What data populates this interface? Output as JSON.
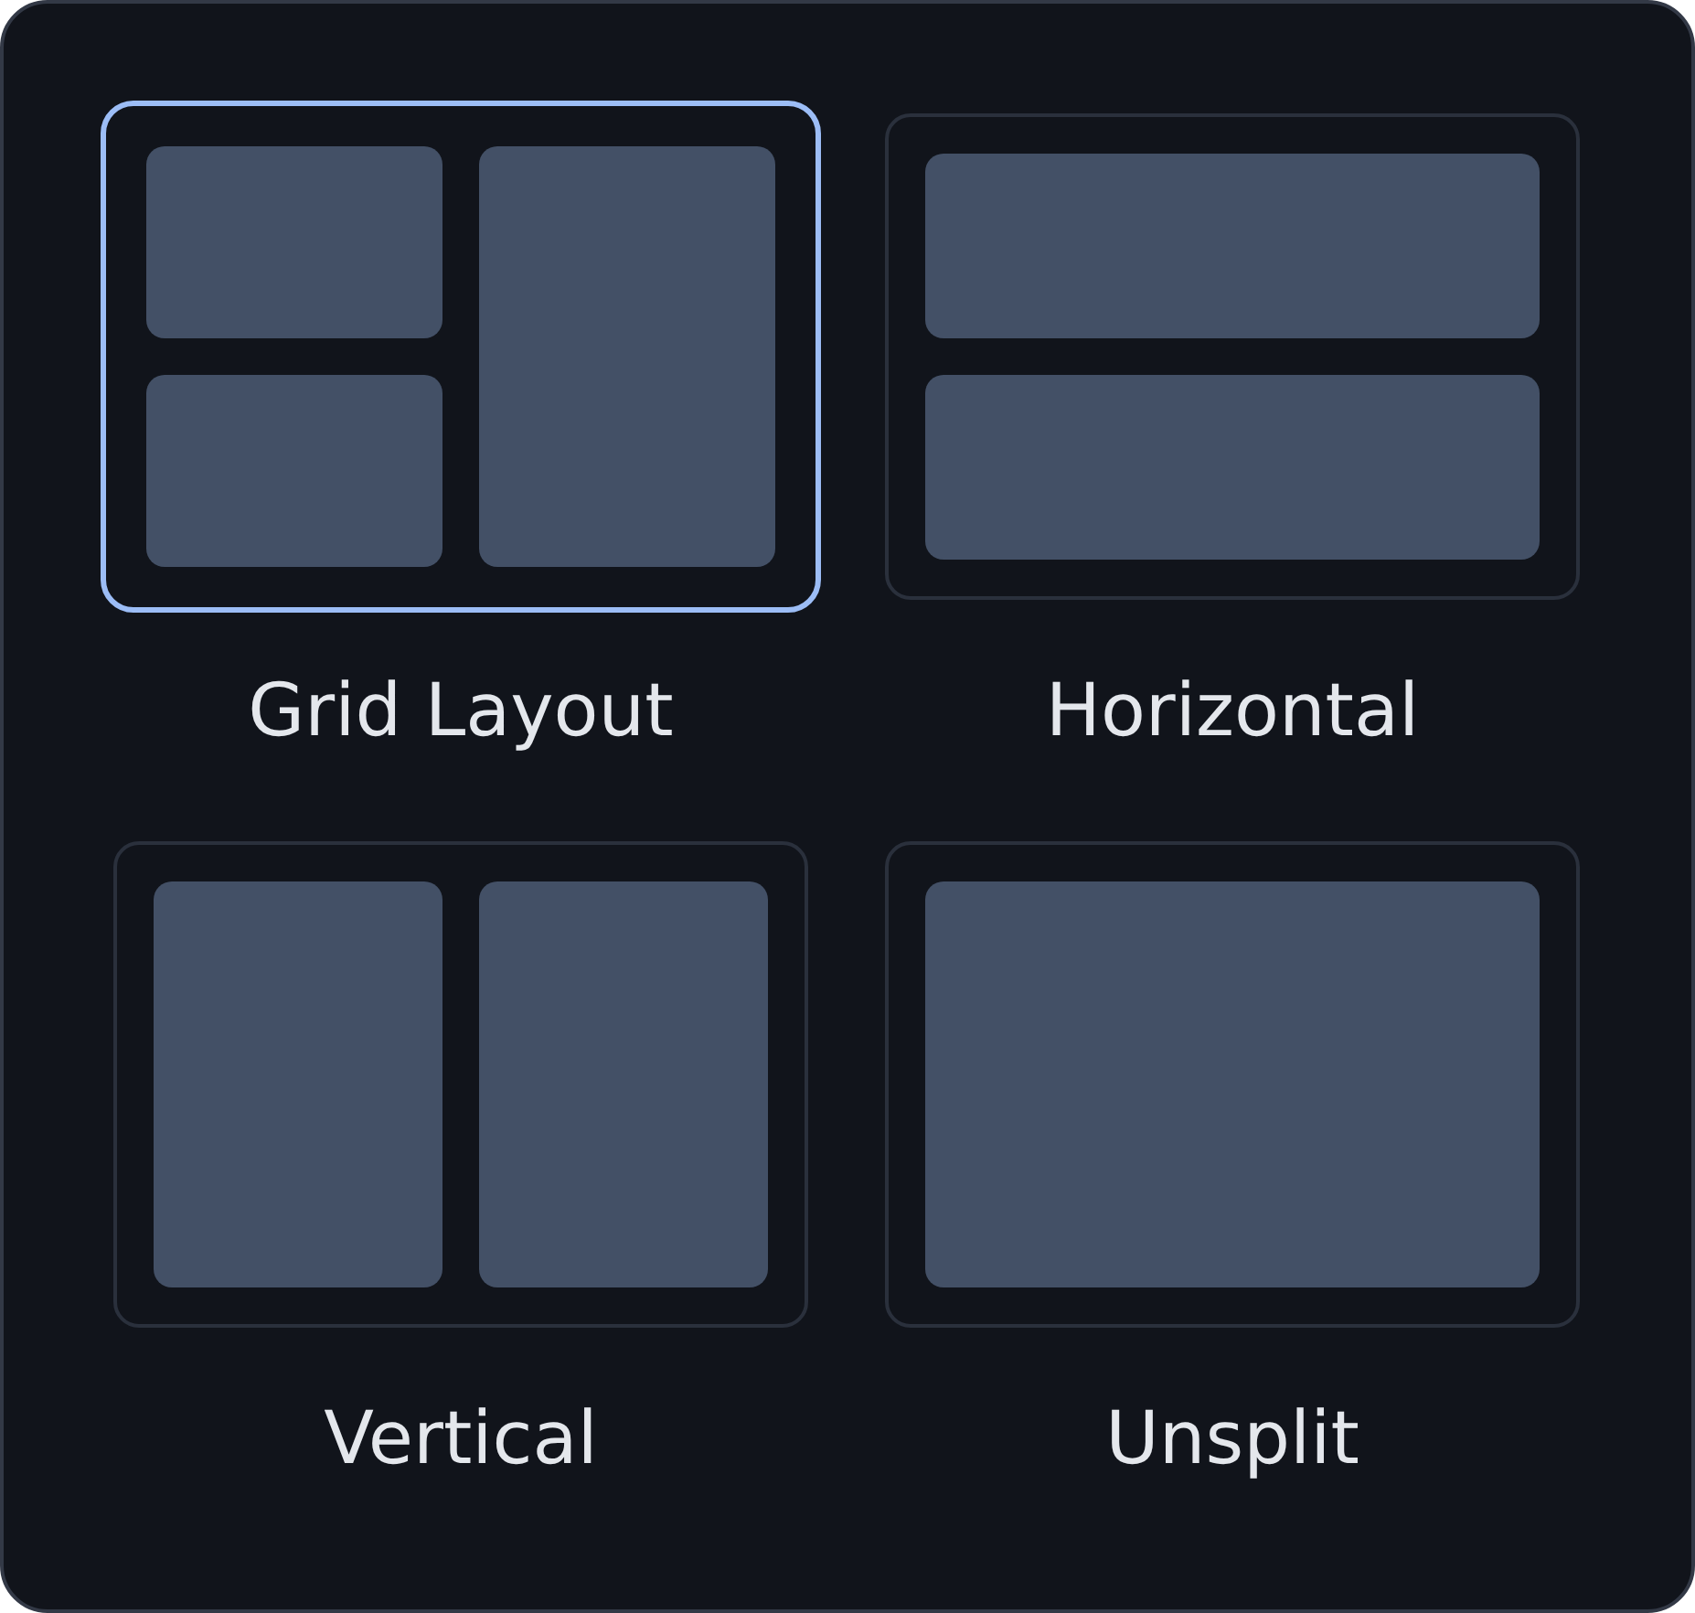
{
  "layouts": [
    {
      "label": "Grid Layout",
      "kind": "grid",
      "selected": true
    },
    {
      "label": "Horizontal",
      "kind": "horizontal",
      "selected": false
    },
    {
      "label": "Vertical",
      "kind": "vertical",
      "selected": false
    },
    {
      "label": "Unsplit",
      "kind": "unsplit",
      "selected": false
    }
  ]
}
